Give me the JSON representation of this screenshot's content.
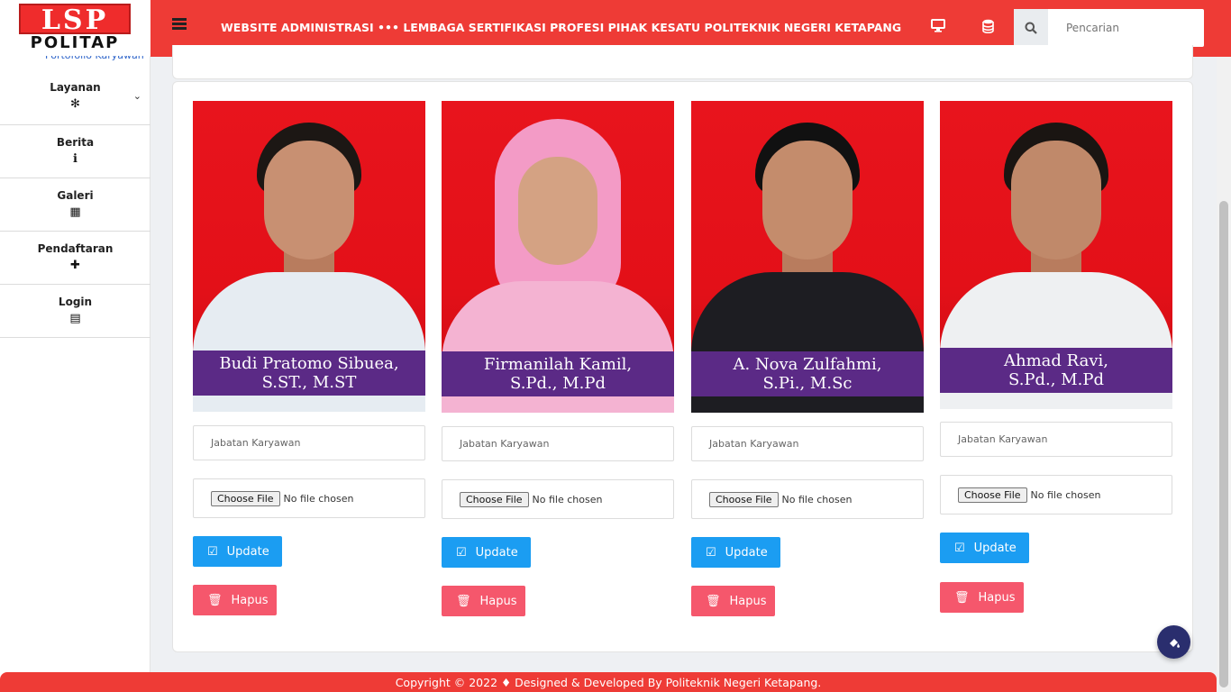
{
  "brand": {
    "top": "LSP",
    "bottom": "POLITAP"
  },
  "sidebar": {
    "partial_link": "Portofolio Karyawan",
    "items": [
      {
        "label": "Layanan",
        "icon": "✻"
      },
      {
        "label": "Berita",
        "icon": "ℹ"
      },
      {
        "label": "Galeri",
        "icon": "▦"
      },
      {
        "label": "Pendaftaran",
        "icon": "✚"
      },
      {
        "label": "Login",
        "icon": "▤"
      }
    ]
  },
  "header": {
    "title": "WEBSITE ADMINISTRASI ••• LEMBAGA SERTIFIKASI PROFESI PIHAK KESATU POLITEKNIK NEGERI KETAPANG",
    "search_placeholder": "Pencarian"
  },
  "staff": [
    {
      "name_line1": "Budi Pratomo Sibuea,",
      "name_line2": "S.ST., M.ST",
      "position_placeholder": "Jabatan Karyawan",
      "choose_file": "Choose File",
      "file_status": "No file chosen",
      "update_label": "Update",
      "delete_label": "Hapus",
      "body_color": "#e6ecf2"
    },
    {
      "name_line1": "Firmanilah Kamil,",
      "name_line2": "S.Pd., M.Pd",
      "position_placeholder": "Jabatan Karyawan",
      "choose_file": "Choose File",
      "file_status": "No file chosen",
      "update_label": "Update",
      "delete_label": "Hapus",
      "body_color": "#f4b3d2"
    },
    {
      "name_line1": "A. Nova Zulfahmi,",
      "name_line2": "S.Pi., M.Sc",
      "position_placeholder": "Jabatan Karyawan",
      "choose_file": "Choose File",
      "file_status": "No file chosen",
      "update_label": "Update",
      "delete_label": "Hapus",
      "body_color": "#1d1d22"
    },
    {
      "name_line1": "Ahmad Ravi,",
      "name_line2": "S.Pd., M.Pd",
      "position_placeholder": "Jabatan Karyawan",
      "choose_file": "Choose File",
      "file_status": "No file chosen",
      "update_label": "Update",
      "delete_label": "Hapus",
      "body_color": "#eef0f2"
    }
  ],
  "footer": {
    "text": "Copyright © 2022 ♦ Designed & Developed By Politeknik Negeri Ketapang."
  },
  "colors": {
    "header": "#ee3b36",
    "update": "#1b9df2",
    "hapus": "#f5576c",
    "nameplate": "#5b2a86"
  }
}
